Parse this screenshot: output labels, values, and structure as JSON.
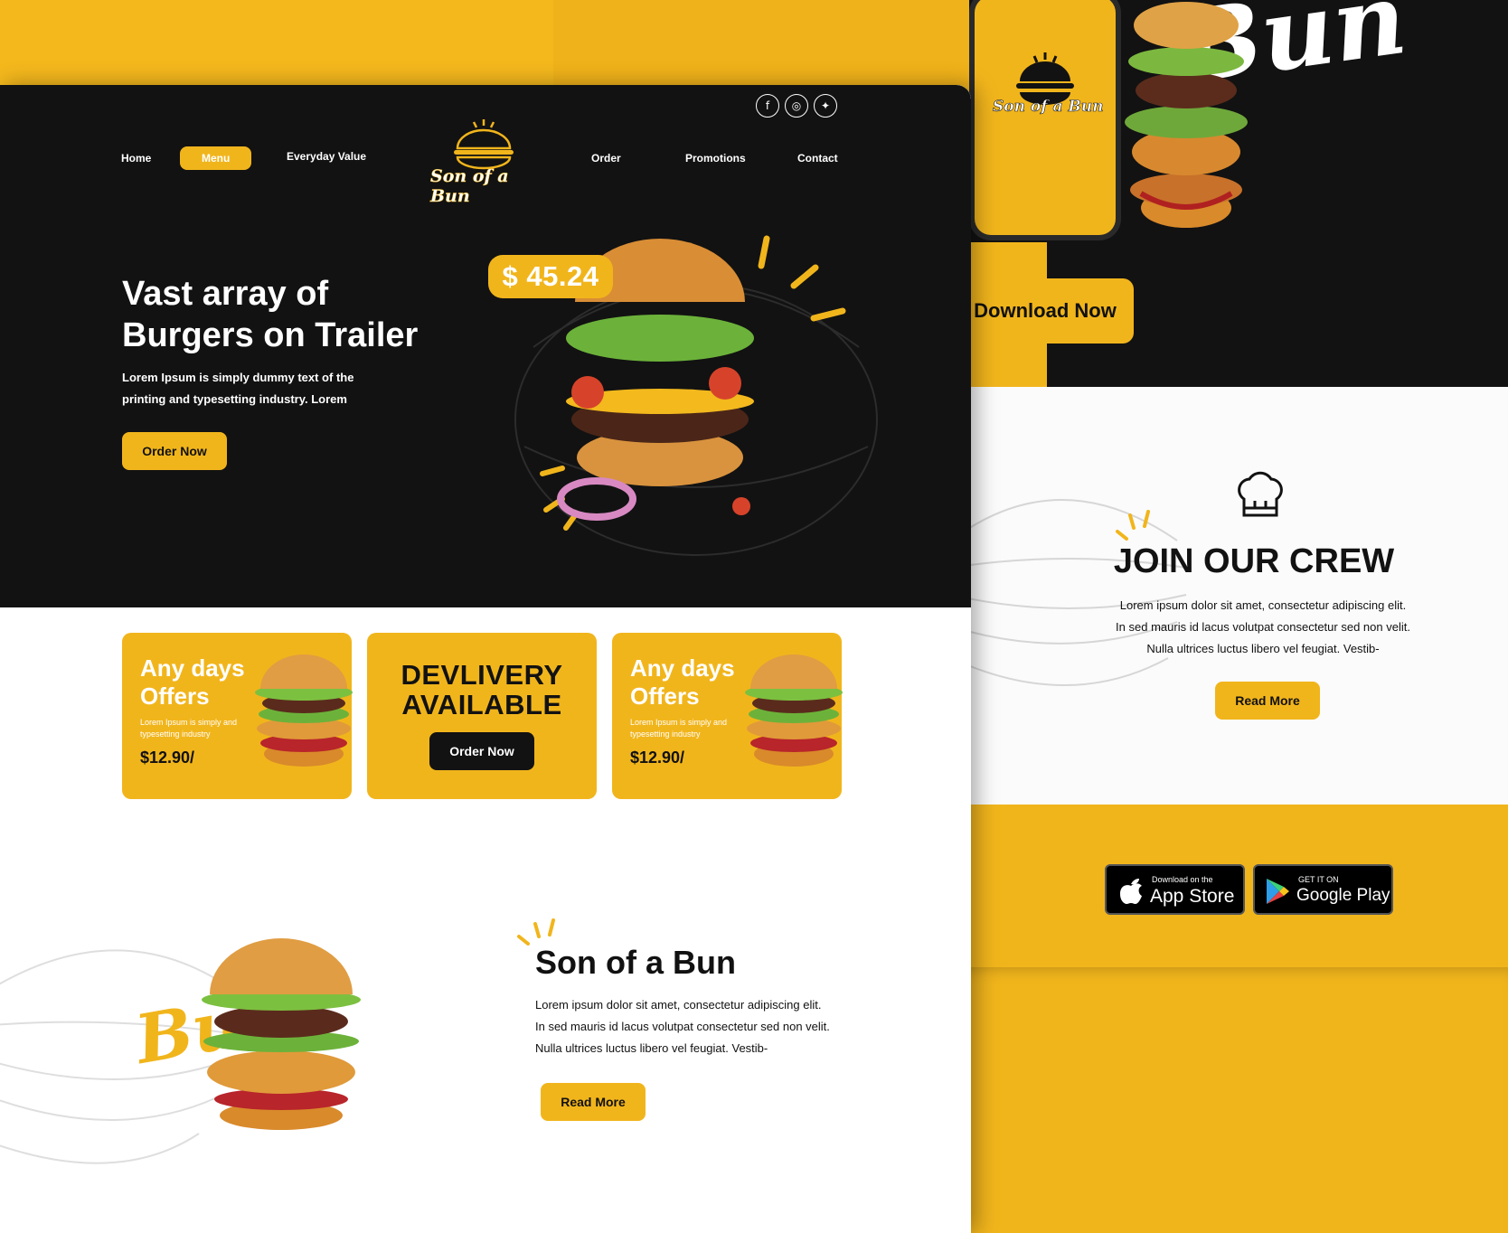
{
  "brand": {
    "name": "Son of a Bun",
    "watermark": "Bun"
  },
  "social": [
    {
      "name": "facebook-icon",
      "glyph": "f"
    },
    {
      "name": "instagram-icon",
      "glyph": "◎"
    },
    {
      "name": "twitter-icon",
      "glyph": "✦"
    }
  ],
  "nav": {
    "home": "Home",
    "menu": "Menu",
    "everyday_value": "Everyday Value",
    "order": "Order",
    "promotions": "Promotions",
    "contact": "Contact"
  },
  "hero": {
    "title": "Vast array of Burgers on Trailer",
    "description": "Lorem Ipsum is simply dummy text of the printing and typesetting industry. Lorem",
    "button": "Order Now",
    "price": "$ 45.24"
  },
  "cards": {
    "offer_title": "Any days Offers",
    "offer_sub": "Lorem Ipsum is simply and typesetting industry",
    "offer_price": "$12.90/",
    "delivery_title": "DEVLIVERY AVAILABLE",
    "delivery_button": "Order Now"
  },
  "about": {
    "title": "Son of a Bun",
    "text": "Lorem ipsum dolor sit amet, consectetur adipiscing elit. In sed mauris id lacus volutpat consectetur sed non velit. Nulla ultrices luctus libero vel feugiat. Vestib-",
    "button": "Read More"
  },
  "app": {
    "download_button": "Download Now"
  },
  "crew": {
    "title": "JOIN OUR CREW",
    "text": "Lorem ipsum dolor sit amet, consectetur adipiscing elit. In sed mauris id lacus volutpat consectetur sed non velit. Nulla ultrices luctus libero vel feugiat. Vestib-",
    "button": "Read More"
  },
  "stores": {
    "apple_small": "Download on the",
    "apple_big": "App Store",
    "google_small": "GET IT ON",
    "google_big": "Google Play"
  },
  "colors": {
    "accent": "#f1b51c",
    "dark": "#121212",
    "white": "#ffffff"
  }
}
